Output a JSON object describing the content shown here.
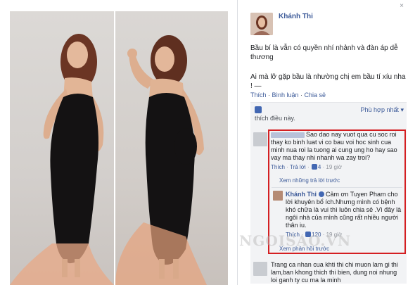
{
  "window": {
    "close_glyph": "×"
  },
  "poster": {
    "name": "Khánh Thi"
  },
  "post": {
    "line1": "Bầu bí là vẫn có quyền nhí nhảnh và đàn áp dễ thương",
    "line2": "Ai mà lỡ gặp bầu là nhường chị em bầu tí xíu nha ! —"
  },
  "post_actions": {
    "like": "Thích",
    "comment": "Bình luận",
    "share": "Chia sẻ",
    "sep": " · "
  },
  "feedback": {
    "sort_label": "Phù hợp nhất ▾",
    "likes_text": "thích điều này."
  },
  "comment1": {
    "text": "Sao dao nay vuot qua cu soc roi thay ko binh luat vi co bau voi hoc sinh cua minh nua roi la tuong ai cung ung ho hay sao vay ma thay nhi nhanh wa zay troi?",
    "like": "Thích",
    "reply": "Trả lời",
    "likes": "4",
    "time": "19 giờ"
  },
  "view_more_replies": "Xem những trả lời trước",
  "reply": {
    "name": "Khánh Thi",
    "text": "Cảm ơn Tuyen Pham cho lời khuyên bổ ích.Nhưng mình có bệnh khó chữa là vui thì luôn chia sẻ .Vì đây là ngôi nhà của mình cũng rất nhiều người thân iu.",
    "like": "Thích",
    "likes": "120",
    "time": "19 giờ"
  },
  "view_prev": "Xem phản hồi trước",
  "comment3": {
    "text": "Trang ca nhan cua khti thi chi muon lam gi thi lam,ban khong thich thi bien, dung noi nhung loi ganh ty cu ma la minh"
  },
  "watermark": "NGOISAO.VN",
  "colors": {
    "link": "#3b5998",
    "highlight": "#d41f22",
    "muted": "#90949c"
  }
}
